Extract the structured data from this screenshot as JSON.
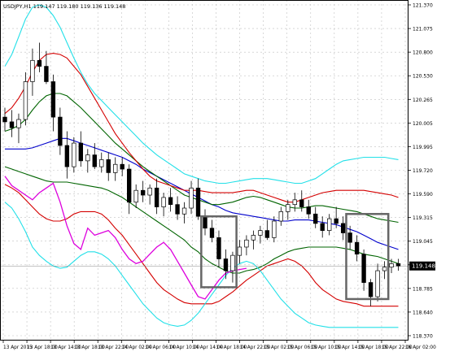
{
  "window": {
    "info_label": "USDJPY,H1  119.147 119.180 119.136 119.148"
  },
  "colors": {
    "background": "#ffffff",
    "grid": "#c0c0c0",
    "candle": "#000000",
    "sma_blue": "#0000cc",
    "bb1_green": "#006400",
    "bb2_red": "#d40000",
    "bb3_cyan": "#22e0e8",
    "chikou_magenta": "#dd00dd",
    "highlight_box": "#666666",
    "price_tag_bg": "#000000",
    "price_tag_text": "#ffffff"
  },
  "chart_data": {
    "type": "candlestick",
    "symbol": "USDJPY",
    "timeframe": "H1",
    "ylim": [
      118.57,
      121.37
    ],
    "y_ticks": [
      "121.370",
      "121.075",
      "120.800",
      "120.530",
      "120.265",
      "120.005",
      "119.995",
      "119.720",
      "119.590",
      "119.315",
      "119.045",
      "118.960",
      "118.785",
      "118.640",
      "118.370"
    ],
    "price_tag": "119.148",
    "x_ticks": [
      "13 Apr 2015",
      "13 Apr 18:00",
      "13 Apr 14:00",
      "13 Apr 18:00",
      "13 Apr 22:00",
      "14 Apr 02:00",
      "14 Apr 06:00",
      "14 Apr 10:00",
      "14 Apr 14:00",
      "14 Apr 18:00",
      "14 Apr 22:00",
      "15 Apr 02:00",
      "15 Apr 06:00",
      "15 Apr 10:00",
      "15 Apr 14:00",
      "15 Apr 18:00",
      "15 Apr 22:00",
      "16 Apr 02:00"
    ],
    "candles": [
      [
        120.42,
        120.5,
        120.3,
        120.38
      ],
      [
        120.38,
        120.48,
        120.25,
        120.33
      ],
      [
        120.33,
        120.45,
        120.2,
        120.4
      ],
      [
        120.4,
        120.8,
        120.35,
        120.72
      ],
      [
        120.72,
        121.0,
        120.6,
        120.9
      ],
      [
        120.9,
        121.05,
        120.8,
        120.85
      ],
      [
        120.85,
        120.98,
        120.7,
        120.72
      ],
      [
        120.72,
        120.78,
        120.3,
        120.42
      ],
      [
        120.42,
        120.5,
        120.1,
        120.18
      ],
      [
        120.18,
        120.3,
        119.9,
        120.0
      ],
      [
        120.0,
        120.25,
        119.95,
        120.2
      ],
      [
        120.2,
        120.3,
        120.0,
        120.05
      ],
      [
        120.05,
        120.15,
        119.95,
        120.1
      ],
      [
        120.1,
        120.2,
        119.98,
        120.0
      ],
      [
        120.0,
        120.12,
        119.95,
        120.06
      ],
      [
        120.06,
        120.12,
        119.88,
        119.95
      ],
      [
        119.95,
        120.08,
        119.88,
        120.02
      ],
      [
        120.02,
        120.08,
        119.92,
        119.98
      ],
      [
        119.98,
        120.02,
        119.6,
        119.7
      ],
      [
        119.7,
        119.85,
        119.65,
        119.8
      ],
      [
        119.8,
        119.88,
        119.7,
        119.76
      ],
      [
        119.76,
        119.85,
        119.68,
        119.82
      ],
      [
        119.82,
        119.9,
        119.6,
        119.66
      ],
      [
        119.66,
        119.78,
        119.58,
        119.74
      ],
      [
        119.74,
        119.82,
        119.62,
        119.68
      ],
      [
        119.68,
        119.75,
        119.55,
        119.6
      ],
      [
        119.6,
        119.7,
        119.52,
        119.65
      ],
      [
        119.65,
        119.88,
        119.6,
        119.82
      ],
      [
        119.82,
        119.9,
        119.55,
        119.58
      ],
      [
        119.58,
        119.64,
        119.42,
        119.48
      ],
      [
        119.48,
        119.55,
        119.36,
        119.4
      ],
      [
        119.4,
        119.46,
        119.15,
        119.22
      ],
      [
        119.22,
        119.3,
        119.05,
        119.12
      ],
      [
        119.12,
        119.28,
        119.02,
        119.25
      ],
      [
        119.25,
        119.38,
        119.18,
        119.32
      ],
      [
        119.32,
        119.42,
        119.25,
        119.38
      ],
      [
        119.38,
        119.46,
        119.3,
        119.42
      ],
      [
        119.42,
        119.5,
        119.35,
        119.46
      ],
      [
        119.46,
        119.55,
        119.38,
        119.4
      ],
      [
        119.4,
        119.58,
        119.36,
        119.54
      ],
      [
        119.54,
        119.66,
        119.5,
        119.62
      ],
      [
        119.62,
        119.72,
        119.55,
        119.68
      ],
      [
        119.68,
        119.78,
        119.62,
        119.72
      ],
      [
        119.72,
        119.8,
        119.62,
        119.66
      ],
      [
        119.66,
        119.72,
        119.56,
        119.6
      ],
      [
        119.6,
        119.66,
        119.48,
        119.52
      ],
      [
        119.52,
        119.58,
        119.4,
        119.46
      ],
      [
        119.46,
        119.6,
        119.42,
        119.56
      ],
      [
        119.56,
        119.66,
        119.48,
        119.52
      ],
      [
        119.52,
        119.58,
        119.38,
        119.44
      ],
      [
        119.44,
        119.5,
        119.3,
        119.36
      ],
      [
        119.36,
        119.42,
        119.2,
        119.26
      ],
      [
        119.26,
        119.3,
        118.95,
        119.02
      ],
      [
        119.02,
        119.05,
        118.82,
        118.9
      ],
      [
        118.9,
        119.18,
        118.86,
        119.12
      ],
      [
        119.12,
        119.2,
        119.05,
        119.15
      ],
      [
        119.15,
        119.22,
        119.1,
        119.18
      ],
      [
        119.18,
        119.22,
        119.12,
        119.16
      ]
    ],
    "series": [
      {
        "name": "",
        "values": [
          120.15,
          120.15,
          120.15,
          120.15,
          120.16,
          120.18,
          120.2,
          120.22,
          120.24,
          120.24,
          120.22,
          120.2,
          120.18,
          120.16,
          120.14,
          120.12,
          120.1,
          120.08,
          120.05,
          120.02,
          119.98,
          119.95,
          119.92,
          119.89,
          119.86,
          119.83,
          119.8,
          119.77,
          119.74,
          119.71,
          119.68,
          119.66,
          119.63,
          119.61,
          119.6,
          119.59,
          119.58,
          119.57,
          119.56,
          119.55,
          119.54,
          119.54,
          119.55,
          119.55,
          119.55,
          119.54,
          119.53,
          119.52,
          119.51,
          119.49,
          119.47,
          119.45,
          119.42,
          119.39,
          119.36,
          119.34,
          119.32,
          119.3
        ]
      },
      {
        "name": "",
        "values": [
          120.3,
          120.32,
          120.35,
          120.4,
          120.48,
          120.55,
          120.6,
          120.62,
          120.62,
          120.6,
          120.55,
          120.5,
          120.44,
          120.38,
          120.32,
          120.26,
          120.2,
          120.15,
          120.1,
          120.05,
          120.0,
          119.96,
          119.92,
          119.88,
          119.84,
          119.8,
          119.76,
          119.74,
          119.72,
          119.7,
          119.68,
          119.68,
          119.69,
          119.7,
          119.72,
          119.74,
          119.75,
          119.74,
          119.72,
          119.7,
          119.68,
          119.66,
          119.65,
          119.65,
          119.66,
          119.67,
          119.67,
          119.66,
          119.65,
          119.64,
          119.63,
          119.62,
          119.6,
          119.58,
          119.56,
          119.55,
          119.54,
          119.53
        ]
      },
      {
        "name": "",
        "values": [
          120.0,
          119.98,
          119.96,
          119.94,
          119.92,
          119.9,
          119.88,
          119.87,
          119.87,
          119.87,
          119.86,
          119.85,
          119.84,
          119.83,
          119.82,
          119.8,
          119.77,
          119.74,
          119.7,
          119.66,
          119.62,
          119.58,
          119.54,
          119.5,
          119.46,
          119.42,
          119.38,
          119.32,
          119.28,
          119.22,
          119.18,
          119.15,
          119.12,
          119.1,
          119.1,
          119.12,
          119.13,
          119.15,
          119.18,
          119.22,
          119.25,
          119.28,
          119.3,
          119.31,
          119.32,
          119.32,
          119.32,
          119.32,
          119.32,
          119.31,
          119.3,
          119.28,
          119.26,
          119.25,
          119.24,
          119.22,
          119.2,
          119.18
        ]
      },
      {
        "name": "",
        "values": [
          120.45,
          120.5,
          120.58,
          120.68,
          120.8,
          120.9,
          120.95,
          120.96,
          120.95,
          120.92,
          120.85,
          120.78,
          120.68,
          120.58,
          120.48,
          120.38,
          120.28,
          120.2,
          120.12,
          120.05,
          119.98,
          119.92,
          119.88,
          119.86,
          119.84,
          119.82,
          119.8,
          119.8,
          119.8,
          119.79,
          119.78,
          119.78,
          119.78,
          119.78,
          119.79,
          119.8,
          119.8,
          119.78,
          119.76,
          119.74,
          119.72,
          119.7,
          119.7,
          119.72,
          119.74,
          119.76,
          119.78,
          119.79,
          119.8,
          119.8,
          119.8,
          119.8,
          119.8,
          119.79,
          119.78,
          119.77,
          119.76,
          119.74
        ]
      },
      {
        "name": "",
        "values": [
          119.85,
          119.82,
          119.78,
          119.72,
          119.66,
          119.6,
          119.56,
          119.54,
          119.54,
          119.56,
          119.6,
          119.62,
          119.62,
          119.62,
          119.6,
          119.55,
          119.48,
          119.42,
          119.34,
          119.26,
          119.18,
          119.1,
          119.02,
          118.96,
          118.92,
          118.88,
          118.85,
          118.84,
          118.84,
          118.84,
          118.84,
          118.86,
          118.9,
          118.94,
          118.99,
          119.04,
          119.08,
          119.12,
          119.16,
          119.18,
          119.2,
          119.22,
          119.2,
          119.16,
          119.1,
          119.02,
          118.96,
          118.92,
          118.88,
          118.86,
          118.85,
          118.84,
          118.82,
          118.82,
          118.82,
          118.82,
          118.82,
          118.82
        ]
      },
      {
        "name": "",
        "values": [
          120.85,
          120.95,
          121.1,
          121.25,
          121.35,
          121.37,
          121.35,
          121.28,
          121.18,
          121.05,
          120.92,
          120.8,
          120.7,
          120.62,
          120.56,
          120.5,
          120.44,
          120.38,
          120.32,
          120.26,
          120.2,
          120.15,
          120.1,
          120.06,
          120.02,
          119.98,
          119.94,
          119.92,
          119.9,
          119.88,
          119.87,
          119.86,
          119.86,
          119.87,
          119.88,
          119.89,
          119.9,
          119.9,
          119.9,
          119.89,
          119.88,
          119.87,
          119.86,
          119.86,
          119.88,
          119.9,
          119.94,
          119.98,
          120.02,
          120.05,
          120.06,
          120.07,
          120.08,
          120.08,
          120.08,
          120.08,
          120.07,
          120.06
        ]
      },
      {
        "name": "",
        "values": [
          119.7,
          119.65,
          119.56,
          119.45,
          119.32,
          119.25,
          119.2,
          119.16,
          119.14,
          119.15,
          119.2,
          119.25,
          119.28,
          119.28,
          119.26,
          119.22,
          119.16,
          119.08,
          119.0,
          118.92,
          118.84,
          118.78,
          118.72,
          118.68,
          118.66,
          118.65,
          118.66,
          118.7,
          118.76,
          118.84,
          118.92,
          119.0,
          119.08,
          119.14,
          119.18,
          119.2,
          119.18,
          119.12,
          119.04,
          118.96,
          118.88,
          118.82,
          118.76,
          118.72,
          118.68,
          118.66,
          118.65,
          118.64,
          118.64,
          118.64,
          118.64,
          118.64,
          118.64,
          118.64,
          118.64,
          118.64,
          118.64,
          118.64
        ]
      },
      {
        "name": "",
        "values": [
          119.92,
          119.84,
          119.8,
          119.76,
          119.72,
          119.78,
          119.82,
          119.86,
          119.7,
          119.5,
          119.35,
          119.3,
          119.48,
          119.42,
          119.44,
          119.46,
          119.4,
          119.3,
          119.22,
          119.18,
          119.2,
          119.26,
          119.32,
          119.36,
          119.3,
          119.2,
          119.1,
          119.0,
          118.9,
          118.88,
          118.96,
          119.04,
          119.1,
          119.12,
          119.13,
          119.14
        ]
      }
    ],
    "highlight_boxes": [
      {
        "x_from": 29,
        "x_to": 33,
        "y_from": 119.58,
        "y_to": 118.98
      },
      {
        "x_from": 50,
        "x_to": 55,
        "y_from": 119.6,
        "y_to": 118.88
      }
    ]
  }
}
